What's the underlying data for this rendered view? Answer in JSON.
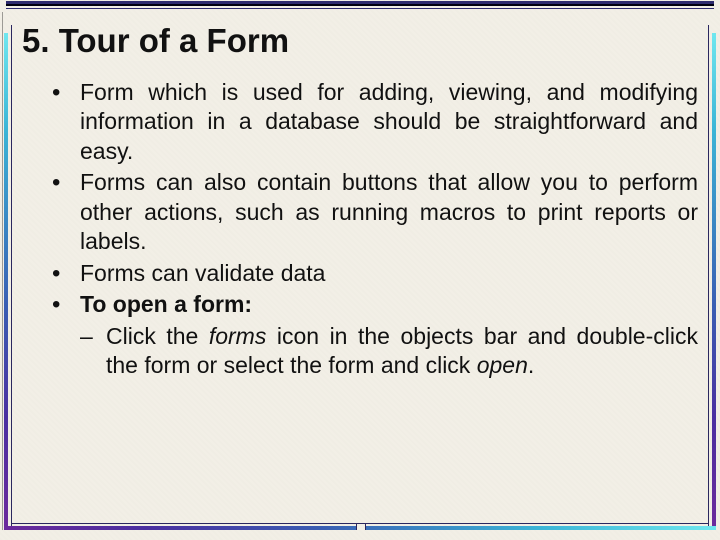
{
  "title": "5. Tour of a Form",
  "bullets": {
    "b1": "Form which is used for adding, viewing, and modifying information in a database should be straightforward and easy.",
    "b2": " Forms can also contain buttons that allow you to perform other actions, such as running macros to print reports or labels.",
    "b3": "Forms can validate data",
    "b4": "To open a form:",
    "sub1_pre": "Click the ",
    "sub1_forms": "forms",
    "sub1_mid": " icon in the objects bar and double-click the form or select the form and click ",
    "sub1_open": "open",
    "sub1_post": "."
  }
}
